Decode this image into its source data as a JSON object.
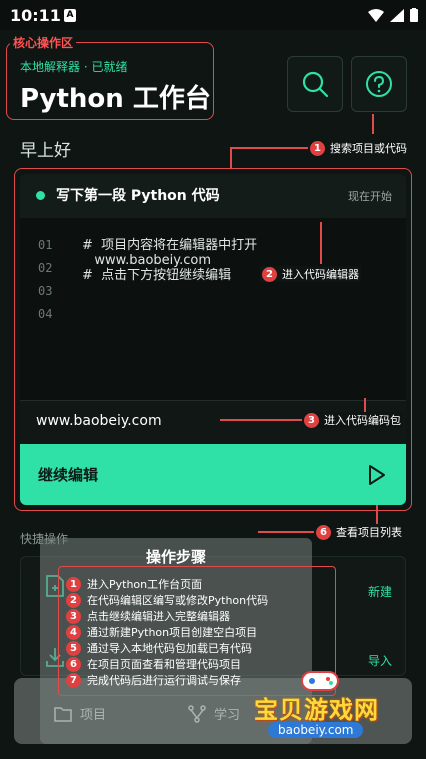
{
  "status_bar": {
    "time": "10:11",
    "notif_letter": "A"
  },
  "header": {
    "tag": "核心操作区",
    "interpreter": "本地解释器 · 已就绪",
    "title": "Python 工作台"
  },
  "greeting": "早上好",
  "annotations": [
    {
      "num": "1",
      "text": "搜索项目或代码"
    },
    {
      "num": "2",
      "text": "进入代码编辑器"
    },
    {
      "num": "3",
      "text": "进入代码编码包"
    },
    {
      "num": "6",
      "text": "查看项目列表"
    }
  ],
  "main_card": {
    "title": "写下第一段 Python 代码",
    "start": "现在开始",
    "line_numbers": [
      "01",
      "02",
      "03",
      "04"
    ],
    "code": [
      "#  项目内容将在编辑器中打开",
      "   www.baobeiy.com",
      "#  点击下方按钮继续编辑"
    ],
    "url": "www.baobeiy.com",
    "continue_label": "继续编辑"
  },
  "quick": {
    "label": "快捷操作",
    "new_label": "新建",
    "import_label": "导入"
  },
  "steps": {
    "title": "操作步骤",
    "items": [
      {
        "num": "1",
        "text": "进入Python工作台页面"
      },
      {
        "num": "2",
        "text": "在代码编辑区编写或修改Python代码"
      },
      {
        "num": "3",
        "text": "点击继续编辑进入完整编辑器"
      },
      {
        "num": "4",
        "text": "通过新建Python项目创建空白项目"
      },
      {
        "num": "5",
        "text": "通过导入本地代码包加载已有代码"
      },
      {
        "num": "6",
        "text": "在项目页面查看和管理代码项目"
      },
      {
        "num": "7",
        "text": "完成代码后进行运行调试与保存"
      }
    ]
  },
  "nav": {
    "projects": "项目",
    "learn": "学习"
  },
  "watermark": {
    "text": "宝贝游戏网",
    "sub": "baobeiy.com"
  },
  "colors": {
    "accent": "#2fe0a7",
    "annotation": "#e04b4b",
    "background": "#0f1513"
  }
}
